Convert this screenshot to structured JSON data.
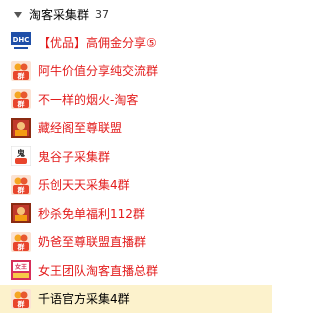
{
  "group": {
    "name": "淘客采集群",
    "count": "37"
  },
  "colors": {
    "selected_row_bg": "#fcf2cc",
    "red_name": "#e31b1b",
    "default_name": "#000000"
  },
  "items": [
    {
      "label": "【优品】高佣金分享⑤",
      "red": true,
      "avatar_icon": "dhc-logo-icon",
      "avatar_text": "DHC"
    },
    {
      "label": "阿牛价值分享纯交流群",
      "red": true,
      "avatar_icon": "group-avatar-icon",
      "avatar_text": "群"
    },
    {
      "label": "不一样的烟火-淘客",
      "red": true,
      "avatar_icon": "group-avatar-icon",
      "avatar_text": "群"
    },
    {
      "label": "藏经阁至尊联盟",
      "red": true,
      "avatar_icon": "group-photo-icon",
      "avatar_text": ""
    },
    {
      "label": "鬼谷子采集群",
      "red": true,
      "avatar_icon": "ghost-avatar-icon",
      "avatar_text": "鬼"
    },
    {
      "label": "乐创天天采集4群",
      "red": true,
      "avatar_icon": "group-avatar-icon",
      "avatar_text": "群"
    },
    {
      "label": "秒杀免单福利112群",
      "red": true,
      "avatar_icon": "group-photo-icon",
      "avatar_text": ""
    },
    {
      "label": "奶爸至尊联盟直播群",
      "red": true,
      "avatar_icon": "group-avatar-icon",
      "avatar_text": "群"
    },
    {
      "label": "女王团队淘客直播总群",
      "red": true,
      "avatar_icon": "queen-avatar-icon",
      "avatar_text": "女王"
    },
    {
      "label": "千语官方采集4群",
      "red": false,
      "avatar_icon": "group-avatar-icon",
      "avatar_text": "群",
      "selected": true
    }
  ]
}
